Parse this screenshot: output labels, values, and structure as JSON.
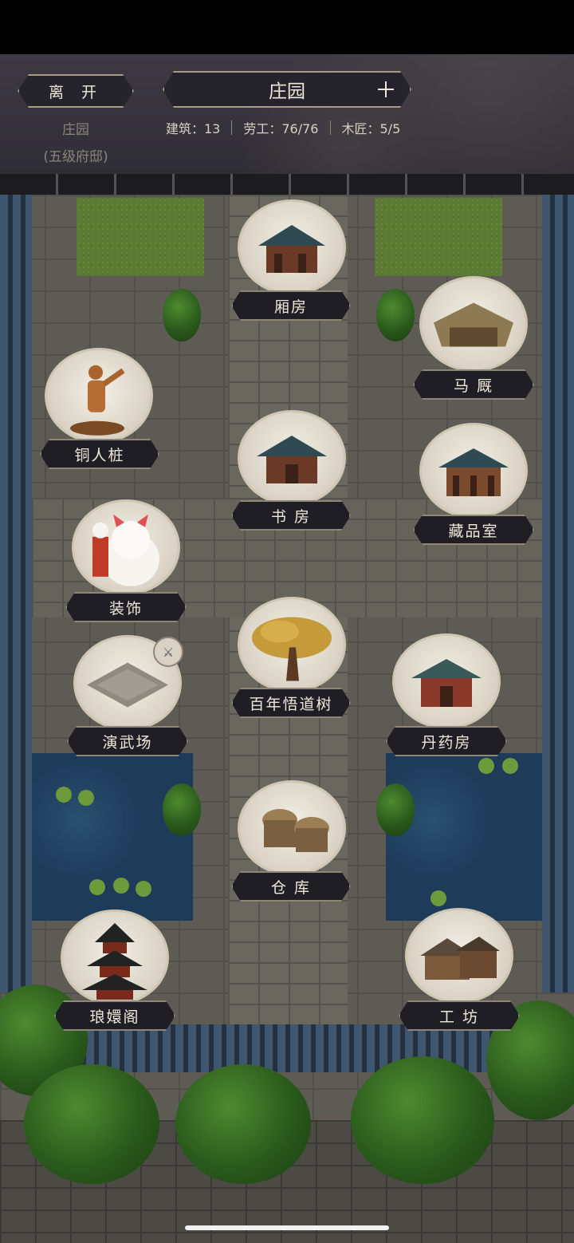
{
  "header": {
    "leave_label": "离 开",
    "title": "庄园",
    "estate_name": "庄园",
    "estate_level": "(五级府邸)",
    "stats": {
      "buildings": "建筑：13",
      "labor": "劳工：76/76",
      "carpenter": "木匠：5/5"
    }
  },
  "buildings": {
    "xiangfang": "厢房",
    "majiu": "马 厩",
    "tongrenzhuang": "铜人桩",
    "shufang": "书 房",
    "cangpinshi": "藏品室",
    "zhuangshi": "装饰",
    "tree": "百年悟道树",
    "yanwuchang": "演武场",
    "danyaofang": "丹药房",
    "cangku": "仓 库",
    "langhuange": "琅嬛阁",
    "gongfang": "工 坊"
  },
  "colors": {
    "header_bg": "#3d3a44",
    "label_bg": "#1f1e25",
    "label_border": "#8f8676",
    "roof_tile": "#2b3a4c",
    "pond": "#1e3b5a"
  }
}
